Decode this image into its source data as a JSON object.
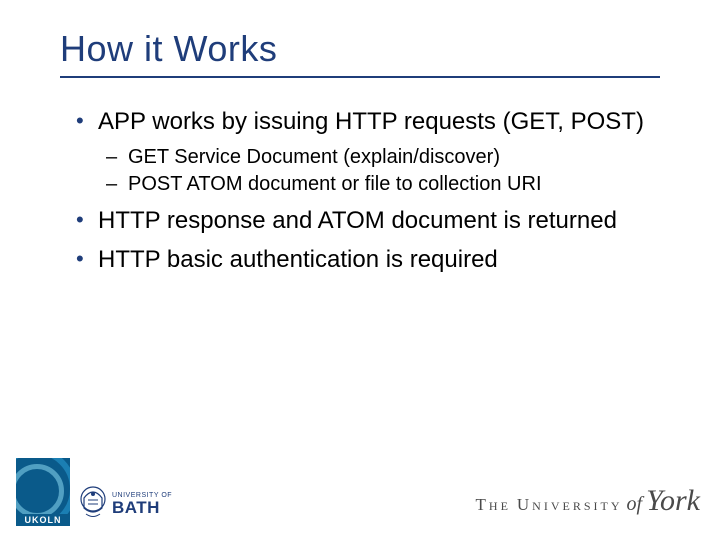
{
  "title": "How it Works",
  "bullets": {
    "b1": "APP works by issuing HTTP requests (GET, POST)",
    "b1_sub1": "GET Service Document (explain/discover)",
    "b1_sub2": "POST ATOM document or file to collection URI",
    "b2": "HTTP response and ATOM document is returned",
    "b3": "HTTP basic authentication is required"
  },
  "logos": {
    "ukoln": "UKOLN",
    "bath_small": "UNIVERSITY OF",
    "bath_big": "BATH",
    "york_the": "The",
    "york_univ": "University",
    "york_of": "of",
    "york_york": "York"
  }
}
